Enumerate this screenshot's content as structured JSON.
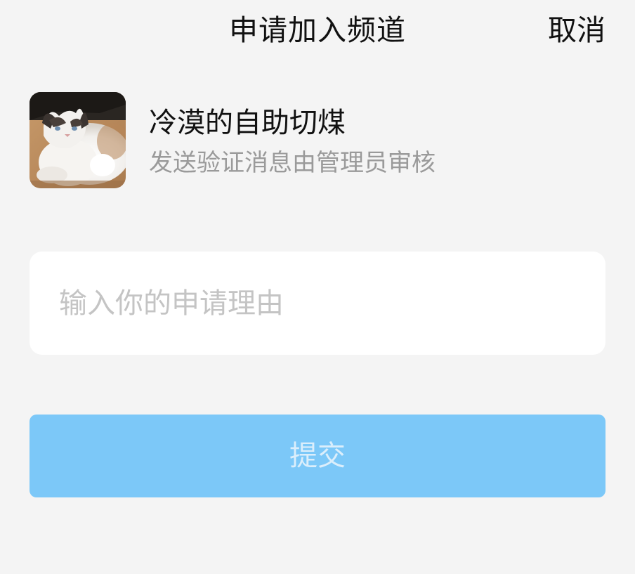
{
  "nav": {
    "title": "申请加入频道",
    "cancel_label": "取消"
  },
  "channel": {
    "name": "冷漠的自助切煤",
    "description": "发送验证消息由管理员审核",
    "avatar_icon": "cat-photo-avatar"
  },
  "reason": {
    "placeholder": "输入你的申请理由",
    "value": ""
  },
  "submit": {
    "label": "提交",
    "state": "disabled"
  },
  "colors": {
    "background": "#f4f4f4",
    "submit_button": "#7cc8f8",
    "submit_text": "#dbeefb",
    "placeholder": "#c4c4c4",
    "description": "#9a9a9a"
  }
}
